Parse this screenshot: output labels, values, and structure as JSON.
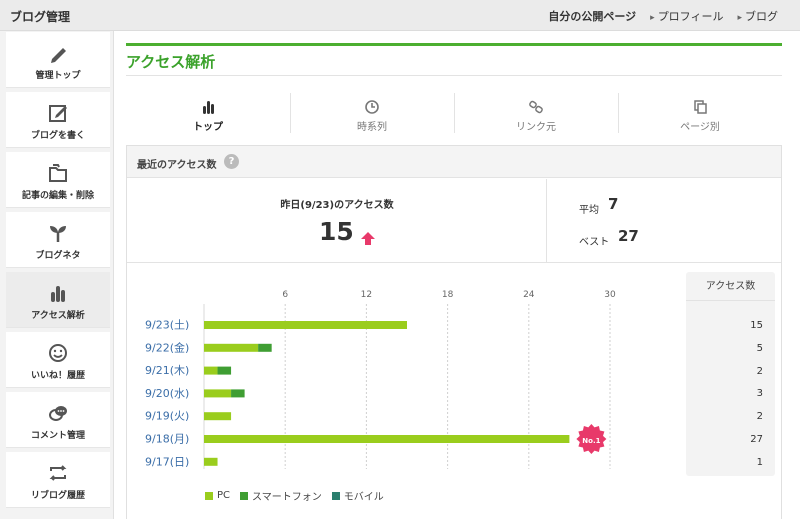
{
  "topbar": {
    "brand": "ブログ管理",
    "links": [
      "自分の公開ページ",
      "プロフィール",
      "ブログ"
    ]
  },
  "sidebar": {
    "items": [
      {
        "label": "管理トップ",
        "icon": "pencil-icon"
      },
      {
        "label": "ブログを書く",
        "icon": "edit-icon"
      },
      {
        "label": "記事の編集・削除",
        "icon": "folders-icon"
      },
      {
        "label": "ブログネタ",
        "icon": "sprout-icon"
      },
      {
        "label": "アクセス解析",
        "icon": "bar-chart-icon",
        "active": true
      },
      {
        "label": "いいね！履歴",
        "icon": "smile-icon"
      },
      {
        "label": "コメント管理",
        "icon": "comment-icon"
      },
      {
        "label": "リブログ履歴",
        "icon": "reblog-icon"
      }
    ]
  },
  "main": {
    "title": "アクセス解析",
    "tabs": [
      {
        "label": "トップ",
        "icon": "bar-chart-icon",
        "active": true
      },
      {
        "label": "時系列",
        "icon": "clock-icon"
      },
      {
        "label": "リンク元",
        "icon": "link-icon"
      },
      {
        "label": "ページ別",
        "icon": "pages-icon"
      }
    ],
    "recent_title": "最近のアクセス数",
    "help": "?",
    "yesterday_label": "昨日(9/23)のアクセス数",
    "yesterday_value": "15",
    "avg_label": "平均",
    "avg_value": "7",
    "best_label": "ベスト",
    "best_value": "27",
    "count_header": "アクセス数",
    "badge": "No.1"
  },
  "colors": {
    "accent": "#3ba22b",
    "pc": "#9acd1d",
    "smartphone": "#3f9e33",
    "mobile": "#2a7f6e",
    "up_arrow": "#e8396a",
    "badge": "#e8396a"
  },
  "chart_data": {
    "type": "bar",
    "orientation": "horizontal",
    "stacked": true,
    "categories": [
      "9/23(土)",
      "9/22(金)",
      "9/21(木)",
      "9/20(水)",
      "9/19(火)",
      "9/18(月)",
      "9/17(日)"
    ],
    "series": [
      {
        "name": "PC",
        "values": [
          15,
          4,
          1,
          2,
          2,
          27,
          1
        ]
      },
      {
        "name": "スマートフォン",
        "values": [
          0,
          1,
          1,
          1,
          0,
          0,
          0
        ]
      },
      {
        "name": "モバイル",
        "values": [
          0,
          0,
          0,
          0,
          0,
          0,
          0
        ]
      }
    ],
    "totals": [
      "15",
      "5",
      "2",
      "3",
      "2",
      "27",
      "1"
    ],
    "xticks": [
      6,
      12,
      18,
      24,
      30
    ],
    "xlim": [
      0,
      30
    ],
    "grid": true,
    "legend": "bottom-left"
  }
}
